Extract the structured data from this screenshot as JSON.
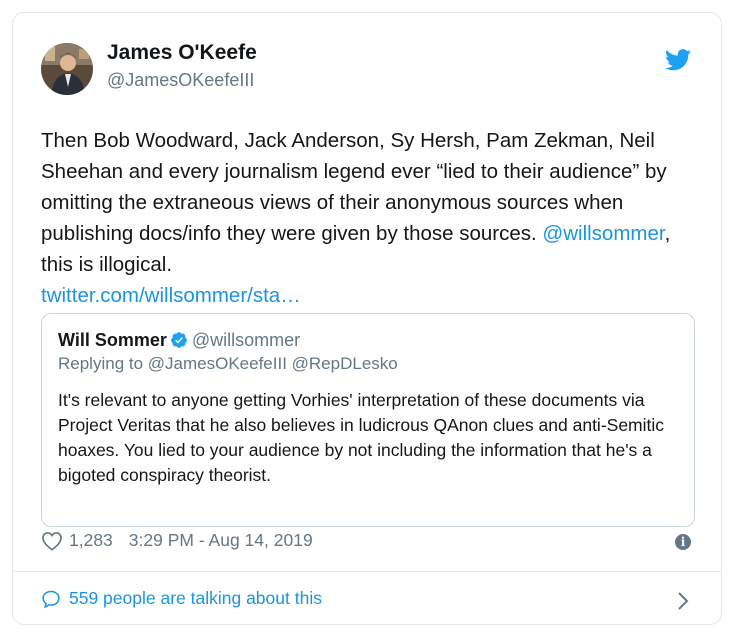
{
  "author": {
    "name": "James O'Keefe",
    "handle": "@JamesOKeefeIII"
  },
  "tweet": {
    "text_before_mention": "Then Bob Woodward, Jack Anderson, Sy Hersh, Pam Zekman, Neil Sheehan and every journalism legend ever “lied to their audience” by omitting the extraneous views of their anonymous sources when publishing docs/info they were given by those sources. ",
    "mention": "@willsommer",
    "text_after_mention": ", this is illogical.",
    "link": "twitter.com/willsommer/sta…"
  },
  "quoted_tweet": {
    "name": "Will Sommer",
    "handle": "@willsommer",
    "replying_to": "Replying to @JamesOKeefeIII @RepDLesko",
    "text": "It's relevant to anyone getting Vorhies' interpretation of these documents via Project Veritas that he also believes in ludicrous QAnon clues and anti-Semitic hoaxes. You lied to your audience by not including the information that he's a bigoted conspiracy theorist."
  },
  "meta": {
    "likes": "1,283",
    "timestamp": "3:29 PM - Aug 14, 2019"
  },
  "footer": {
    "talking": "559 people are talking about this"
  },
  "icons": {
    "bird": "twitter-bird-icon",
    "verified": "verified-badge-icon",
    "heart": "heart-icon",
    "info": "info-icon",
    "bubble": "comment-bubble-icon",
    "chevron": "chevron-right-icon"
  },
  "colors": {
    "accent": "#1b95e0",
    "text": "#14171a",
    "muted": "#657786",
    "border": "#e1e8ed"
  }
}
